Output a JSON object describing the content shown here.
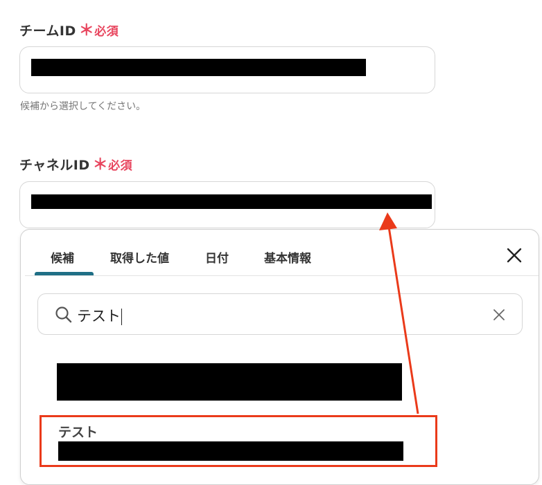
{
  "team_field": {
    "label": "チームID",
    "required_mark": "＊",
    "required_text": "必須",
    "helper": "候補から選択してください。"
  },
  "channel_field": {
    "label": "チャネルID",
    "required_mark": "＊",
    "required_text": "必須"
  },
  "popup": {
    "tabs": [
      {
        "label": "候補"
      },
      {
        "label": "取得した値"
      },
      {
        "label": "日付"
      },
      {
        "label": "基本情報"
      }
    ],
    "search_value": "テスト",
    "results": [
      {
        "title": ""
      },
      {
        "title": "テスト"
      }
    ]
  },
  "colors": {
    "required": "#e8455e",
    "active_tab": "#1f6f86",
    "highlight": "#ea3a1a"
  }
}
